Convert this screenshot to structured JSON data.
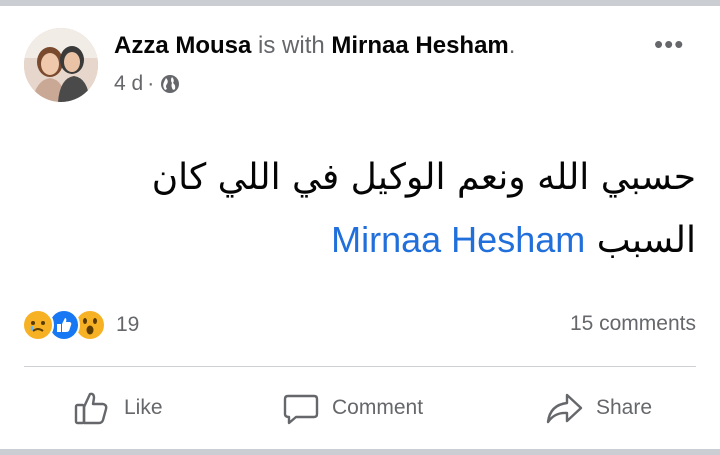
{
  "post": {
    "author": "Azza Mousa",
    "with_text": " is with ",
    "tagged": "Mirnaa Hesham",
    "period": ".",
    "time": "4 d",
    "separator": "·",
    "privacy_icon": "globe-icon",
    "more_label": "•••",
    "text_arabic": "حسبي الله ونعم الوكيل في اللي كان السبب",
    "mention": "Mirnaa Hesham"
  },
  "stats": {
    "reactions": [
      "sad-reaction-icon",
      "like-reaction-icon",
      "wow-reaction-icon"
    ],
    "reaction_count": "19",
    "comments": "15 comments"
  },
  "actions": {
    "like_label": "Like",
    "comment_label": "Comment",
    "share_label": "Share"
  },
  "colors": {
    "mention": "#216fdb",
    "muted": "#65676b",
    "like_blue": "#1877f2",
    "reaction_yellow": "#f7b125"
  }
}
